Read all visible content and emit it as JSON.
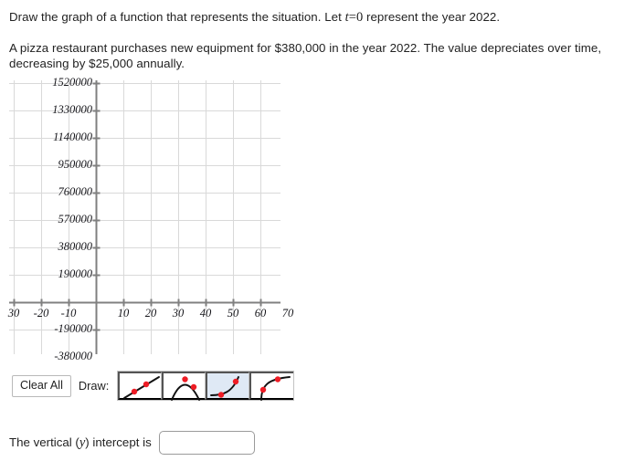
{
  "prompt": {
    "line1_a": "Draw the graph of a function that represents the situation. Let ",
    "line1_var": "t",
    "line1_eq": "=",
    "line1_zero": "0",
    "line1_b": " represent the year 2022.",
    "line2": "A pizza restaurant purchases new equipment for $380,000 in the year 2022. The value depreciates over time, decreasing by $25,000 annually."
  },
  "graph": {
    "y_tick_labels": [
      "1520000",
      "1330000",
      "1140000",
      "950000",
      "760000",
      "570000",
      "380000",
      "190000",
      "-190000",
      "-380000"
    ],
    "x_tick_labels": [
      "30",
      "-20",
      "-10",
      "10",
      "20",
      "30",
      "40",
      "50",
      "60",
      "70"
    ],
    "colors": {
      "grid": "#d9d9d9",
      "axis": "#808080",
      "point": "#ee1c25",
      "curve": "#111111",
      "selected_tool_bg": "#dfe9f5"
    }
  },
  "toolbar": {
    "clear_all_label": "Clear All",
    "draw_label": "Draw:",
    "tools": [
      {
        "name": "linear",
        "selected": false
      },
      {
        "name": "parabola",
        "selected": false
      },
      {
        "name": "exponential",
        "selected": true
      },
      {
        "name": "logarithmic",
        "selected": false
      }
    ]
  },
  "answer": {
    "label_a": "The vertical (",
    "label_var": "y",
    "label_b": ") intercept is",
    "input_value": "",
    "input_placeholder": ""
  },
  "chart_data": {
    "type": "line",
    "title": "",
    "xlabel": "",
    "ylabel": "",
    "xlim": [
      -33,
      70
    ],
    "ylim": [
      -475000,
      1615000
    ],
    "x_tick_values": [
      -30,
      -20,
      -10,
      10,
      20,
      30,
      40,
      50,
      60,
      70
    ],
    "y_tick_values": [
      1520000,
      1330000,
      1140000,
      950000,
      760000,
      570000,
      380000,
      190000,
      -190000,
      -380000
    ],
    "x_tick_step": 10,
    "y_tick_step": 190000,
    "grid": true,
    "legend": "none",
    "series": []
  }
}
